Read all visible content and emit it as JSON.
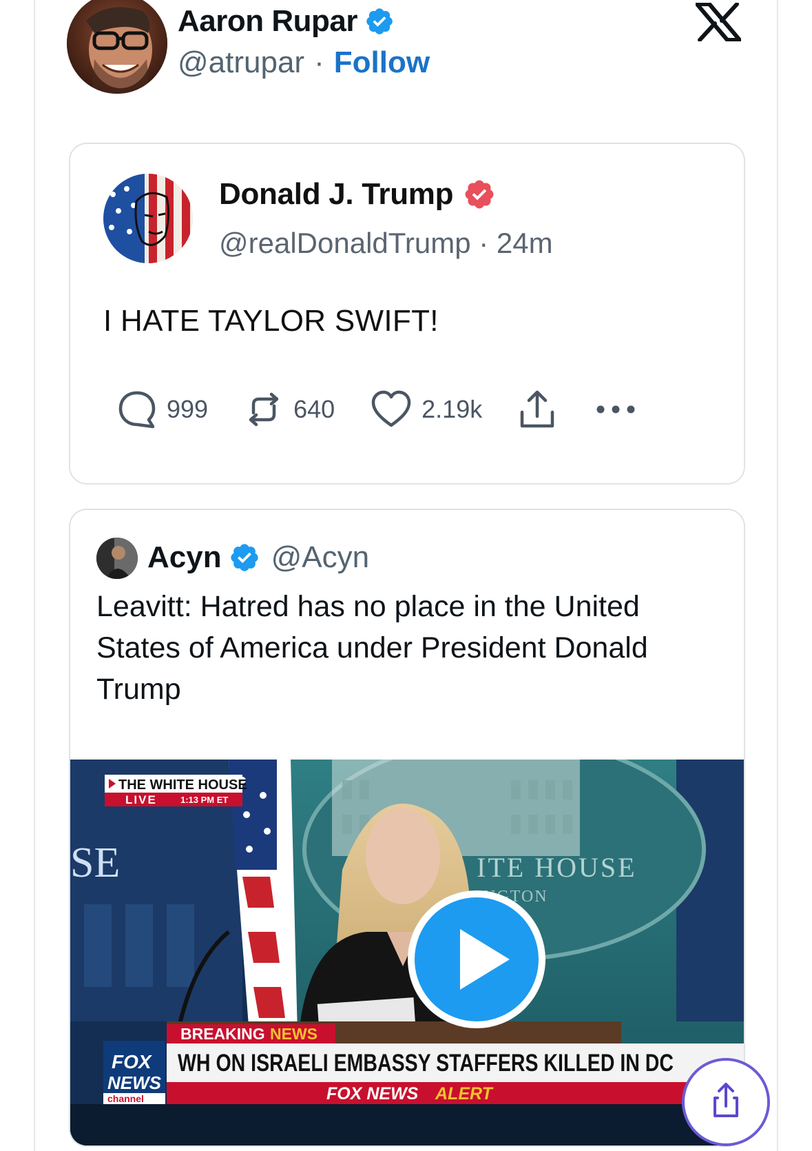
{
  "author": {
    "name": "Aaron Rupar",
    "handle": "@atrupar",
    "separator": "·",
    "follow_label": "Follow"
  },
  "truth_post": {
    "name": "Donald J. Trump",
    "handle": "@realDonaldTrump",
    "separator": "·",
    "time": "24m",
    "text": "I HATE TAYLOR SWIFT!",
    "replies": "999",
    "retruths": "640",
    "likes": "2.19k"
  },
  "quoted_tweet": {
    "name": "Acyn",
    "handle": "@Acyn",
    "text": "Leavitt: Hatred has no place in the United States of America under President Donald Trump"
  },
  "video": {
    "bug_title": "THE WHITE HOUSE",
    "bug_live": "LIVE",
    "bug_time": "1:13 PM ET",
    "wall_left": "SE",
    "wall_right": "ITE HOUSE",
    "wall_right_sub": "INGTON",
    "breaking": "BREAKING",
    "breaking_news": "NEWS",
    "headline": "WH ON ISRAELI EMBASSY STAFFERS KILLED IN DC",
    "alert_fox": "FOX NEWS",
    "alert_word": "ALERT",
    "logo_fox": "FOX",
    "logo_news": "NEWS",
    "logo_channel": "channel"
  },
  "colors": {
    "verified_blue": "#1d9bf0",
    "truth_badge": "#e8505b",
    "follow_blue": "#1a73c8",
    "fox_red": "#c8102e",
    "breaking_gold": "#f2c230"
  },
  "icons": {
    "verified": "verified-badge-icon",
    "x_logo": "x-logo-icon",
    "reply": "speech-bubble-icon",
    "retruth": "repost-arrows-icon",
    "like": "heart-icon",
    "share": "share-upload-icon",
    "more": "more-dots-icon",
    "play": "play-icon"
  }
}
